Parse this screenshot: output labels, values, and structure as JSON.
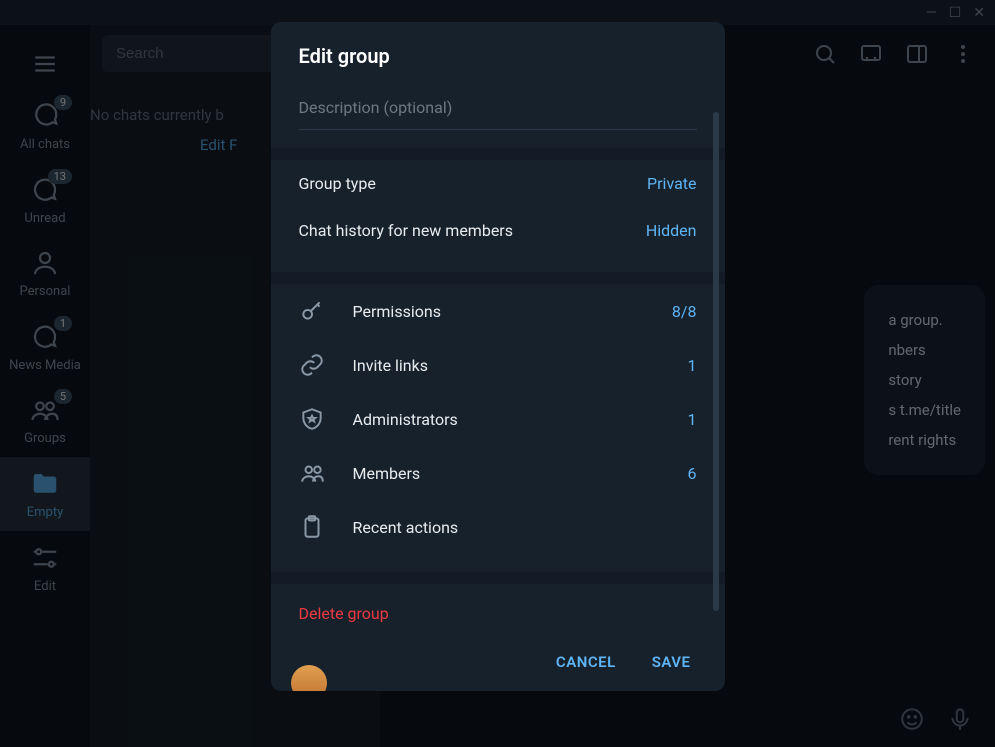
{
  "window": {
    "min": "—",
    "max": "☐",
    "close": "✕"
  },
  "sidebar": {
    "items": [
      {
        "label": "All chats",
        "badge": "9"
      },
      {
        "label": "Unread",
        "badge": "13"
      },
      {
        "label": "Personal",
        "badge": ""
      },
      {
        "label": "News Media",
        "badge": "1"
      },
      {
        "label": "Groups",
        "badge": "5"
      },
      {
        "label": "Empty",
        "badge": ""
      },
      {
        "label": "Edit",
        "badge": ""
      }
    ]
  },
  "chatlist": {
    "search_placeholder": "Search",
    "empty_text": "No chats currently b",
    "edit_link": "Edit F"
  },
  "bg_bubble": {
    "line0": "a group.",
    "line1": "nbers",
    "line2": "story",
    "line3": "s t.me/title",
    "line4": "rent rights"
  },
  "dialog": {
    "title": "Edit group",
    "description_placeholder": "Description (optional)",
    "settings": [
      {
        "label": "Group type",
        "value": "Private"
      },
      {
        "label": "Chat history for new members",
        "value": "Hidden"
      }
    ],
    "items": [
      {
        "label": "Permissions",
        "value": "8/8"
      },
      {
        "label": "Invite links",
        "value": "1"
      },
      {
        "label": "Administrators",
        "value": "1"
      },
      {
        "label": "Members",
        "value": "6"
      },
      {
        "label": "Recent actions",
        "value": ""
      }
    ],
    "delete_label": "Delete group",
    "cancel_label": "CANCEL",
    "save_label": "SAVE"
  }
}
